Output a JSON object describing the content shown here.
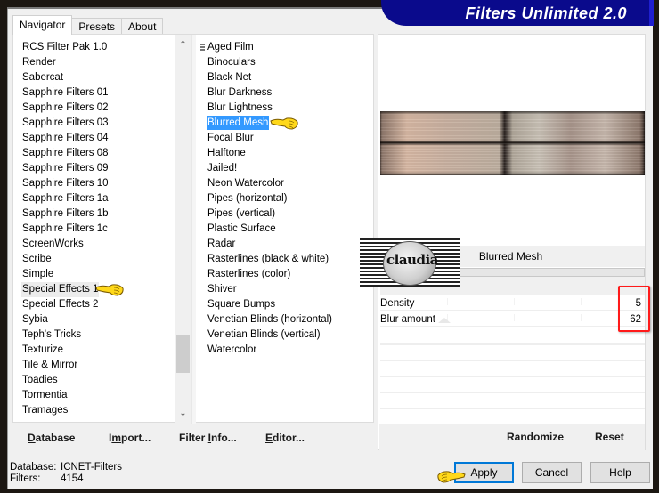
{
  "app": {
    "title": "Filters Unlimited 2.0",
    "accent_color": "#0a0a8c",
    "selection_color": "#3399ff",
    "highlight_box_color": "#ff1a1a"
  },
  "tabs": [
    {
      "label": "Navigator",
      "active": true
    },
    {
      "label": "Presets",
      "active": false
    },
    {
      "label": "About",
      "active": false
    }
  ],
  "categories": {
    "selected": "Special Effects 1",
    "items": [
      "RCS Filter Pak 1.0",
      "Render",
      "Sabercat",
      "Sapphire Filters 01",
      "Sapphire Filters 02",
      "Sapphire Filters 03",
      "Sapphire Filters 04",
      "Sapphire Filters 08",
      "Sapphire Filters 09",
      "Sapphire Filters 10",
      "Sapphire Filters 1a",
      "Sapphire Filters 1b",
      "Sapphire Filters 1c",
      "ScreenWorks",
      "Scribe",
      "Simple",
      "Special Effects 1",
      "Special Effects 2",
      "Sybia",
      "Teph's Tricks",
      "Texturize",
      "Tile & Mirror",
      "Toadies",
      "Tormentia",
      "Tramages"
    ]
  },
  "filters": {
    "selected": "Blurred Mesh",
    "items": [
      "Aged Film",
      "Binoculars",
      "Black Net",
      "Blur Darkness",
      "Blur Lightness",
      "Blurred Mesh",
      "Focal Blur",
      "Halftone",
      "Jailed!",
      "Neon Watercolor",
      "Pipes (horizontal)",
      "Pipes (vertical)",
      "Plastic Surface",
      "Radar",
      "Rasterlines (black & white)",
      "Rasterlines (color)",
      "Shiver",
      "Square Bumps",
      "Venetian Blinds (horizontal)",
      "Venetian Blinds (vertical)",
      "Watercolor"
    ]
  },
  "left_buttons": {
    "database": {
      "pre": "",
      "accel": "D",
      "post": "atabase"
    },
    "import": {
      "pre": "I",
      "accel": "m",
      "post": "port..."
    },
    "filter_info": {
      "pre": "Filter ",
      "accel": "I",
      "post": "nfo..."
    },
    "editor": {
      "pre": "",
      "accel": "E",
      "post": "ditor..."
    }
  },
  "filter_panel": {
    "filter_name": "Blurred Mesh",
    "params": [
      {
        "label": "Density",
        "value": "5"
      },
      {
        "label": "Blur amount",
        "value": "62"
      }
    ],
    "randomize_label": "Randomize",
    "reset_label": "Reset"
  },
  "watermark": {
    "text": "claudia"
  },
  "status": {
    "database_label": "Database:",
    "database_value": "ICNET-Filters",
    "filters_label": "Filters:",
    "filters_value": "4154"
  },
  "dialog_buttons": {
    "apply": "Apply",
    "cancel": "Cancel",
    "help": "Help"
  },
  "scroll_icons": {
    "up": "chevron-up-icon",
    "down": "chevron-down-icon"
  }
}
